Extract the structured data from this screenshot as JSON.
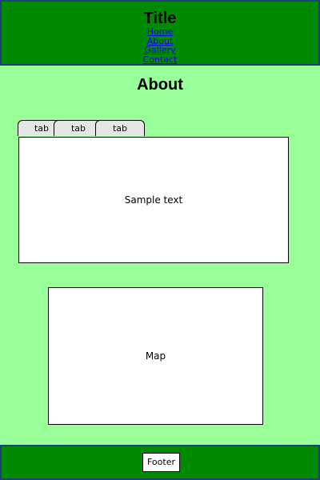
{
  "header": {
    "title": "Title",
    "nav": [
      "Home",
      "About",
      "Gallery",
      "Contact"
    ]
  },
  "main": {
    "heading": "About",
    "tabs": [
      {
        "label": "tab"
      },
      {
        "label": "tab"
      },
      {
        "label": "tab"
      }
    ],
    "panel_text": "Sample text",
    "map_text": "Map"
  },
  "footer": {
    "text": "Footer"
  },
  "colors": {
    "background": "#99FF99",
    "header_footer": "#008A00",
    "border": "#1F3F7A",
    "link": "#0000EE"
  }
}
